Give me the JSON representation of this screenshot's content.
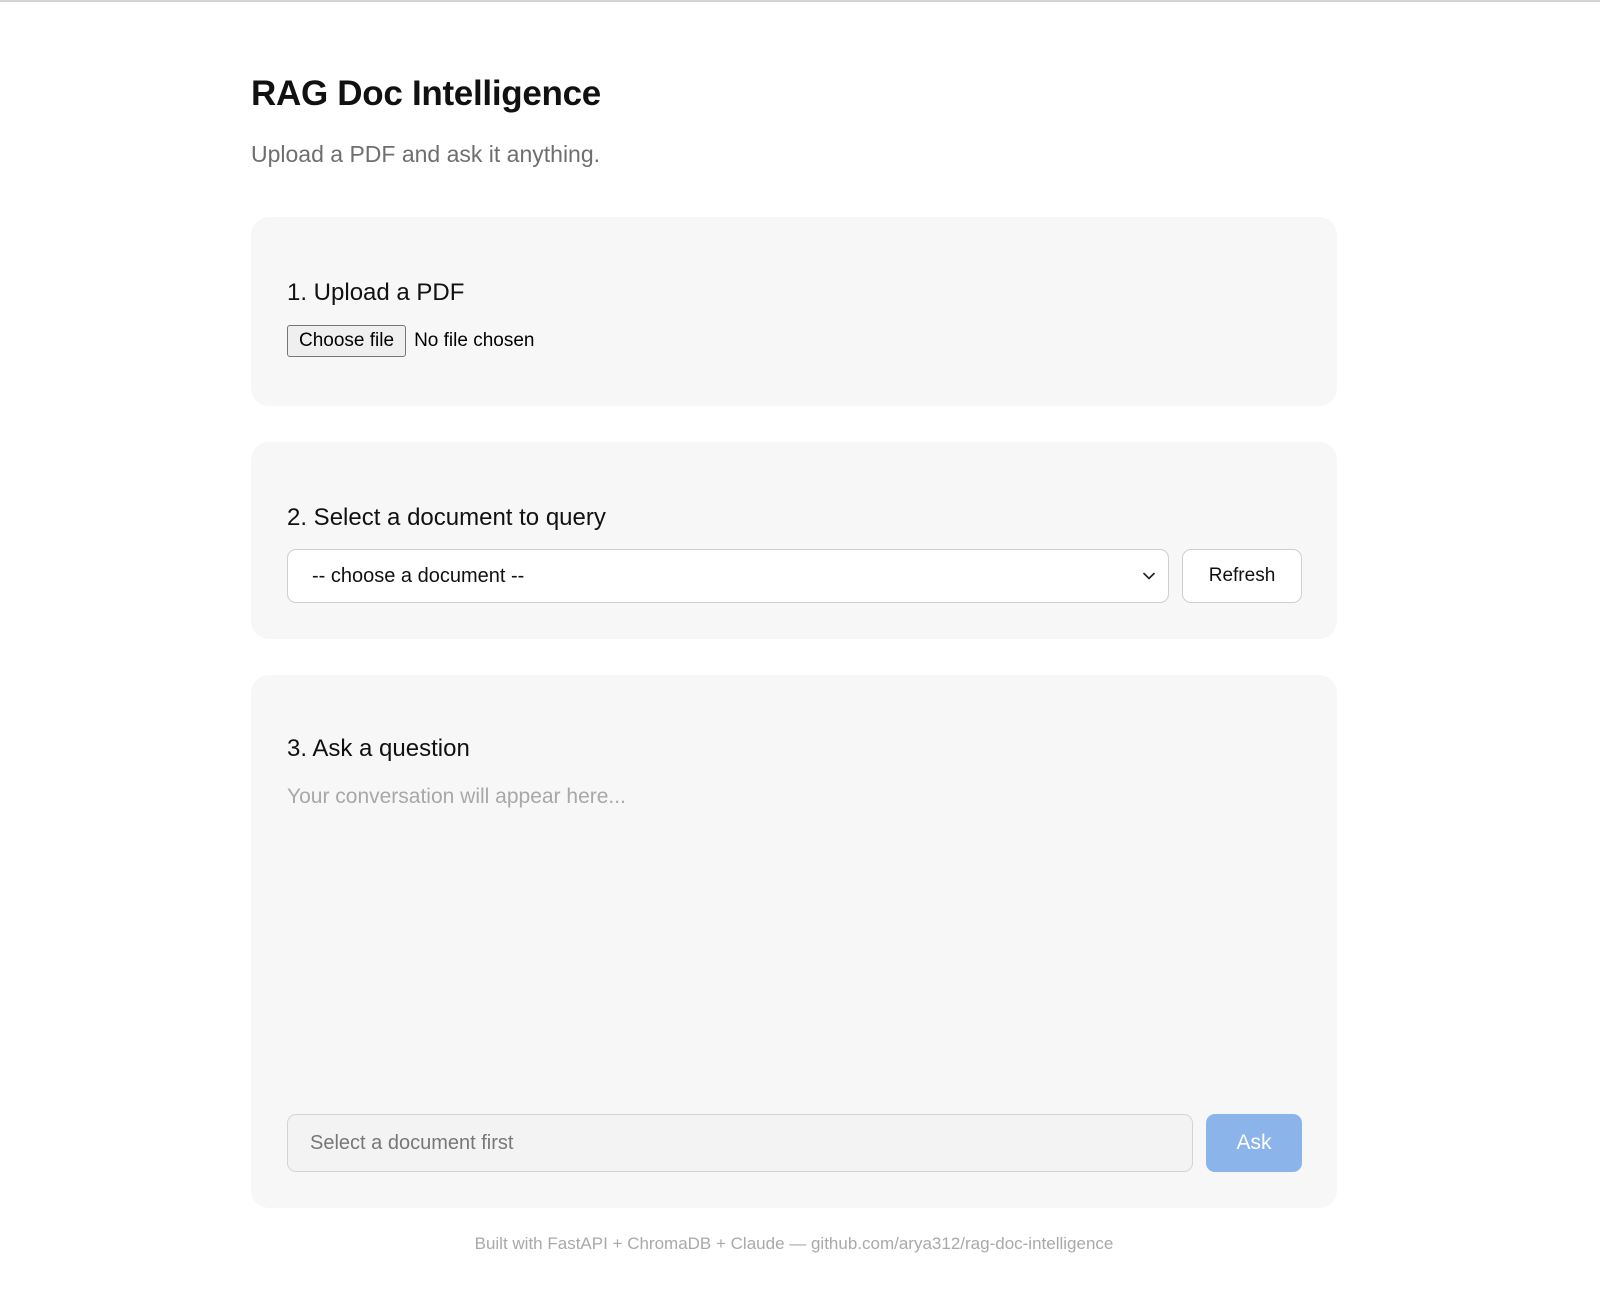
{
  "header": {
    "title": "RAG Doc Intelligence",
    "subtitle": "Upload a PDF and ask it anything."
  },
  "upload": {
    "heading": "1. Upload a PDF",
    "choose_file_label": "Choose file",
    "file_status": "No file chosen"
  },
  "select": {
    "heading": "2. Select a document to query",
    "selected_value": "-- choose a document --",
    "refresh_label": "Refresh"
  },
  "ask": {
    "heading": "3. Ask a question",
    "conversation_placeholder": "Your conversation will appear here...",
    "input_placeholder": "Select a document first",
    "ask_label": "Ask"
  },
  "footer": {
    "text": "Built with FastAPI + ChromaDB + Claude — github.com/arya312/rag-doc-intelligence"
  },
  "colors": {
    "card_background": "#f7f7f7",
    "ask_button": "#8ab4ea",
    "muted_text": "#6e6e6e"
  },
  "icons": {
    "select_chevron": "chevron-down-icon"
  }
}
